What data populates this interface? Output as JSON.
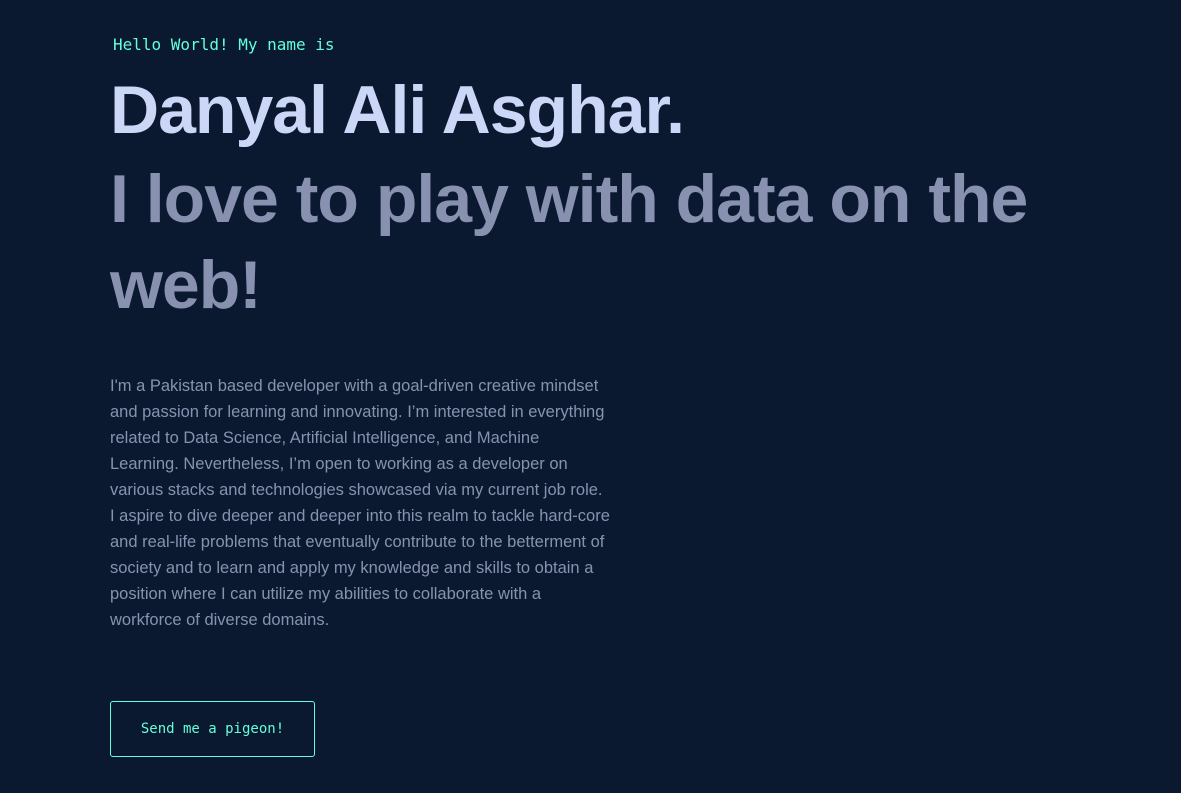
{
  "hero": {
    "greeting": "Hello World! My name is",
    "name": "Danyal Ali Asghar.",
    "tagline": "I love to play with data on the web!",
    "bio": "I'm a Pakistan based developer with a goal-driven creative mindset and passion for learning and innovating. I’m interested in everything related to Data Science, Artificial Intelligence, and Machine Learning. Nevertheless, I’m open to working as a developer on various stacks and technologies showcased via my current job role. I aspire to dive deeper and deeper into this realm to tackle hard-core and real-life problems that eventually contribute to the betterment of society and to learn and apply my knowledge and skills to obtain a position where I can utilize my abilities to collaborate with a workforce of diverse domains.",
    "cta_label": "Send me a pigeon!"
  },
  "colors": {
    "background": "#0a192f",
    "accent": "#64ffda",
    "heading": "#ccd6f6",
    "muted": "#8892b0"
  }
}
